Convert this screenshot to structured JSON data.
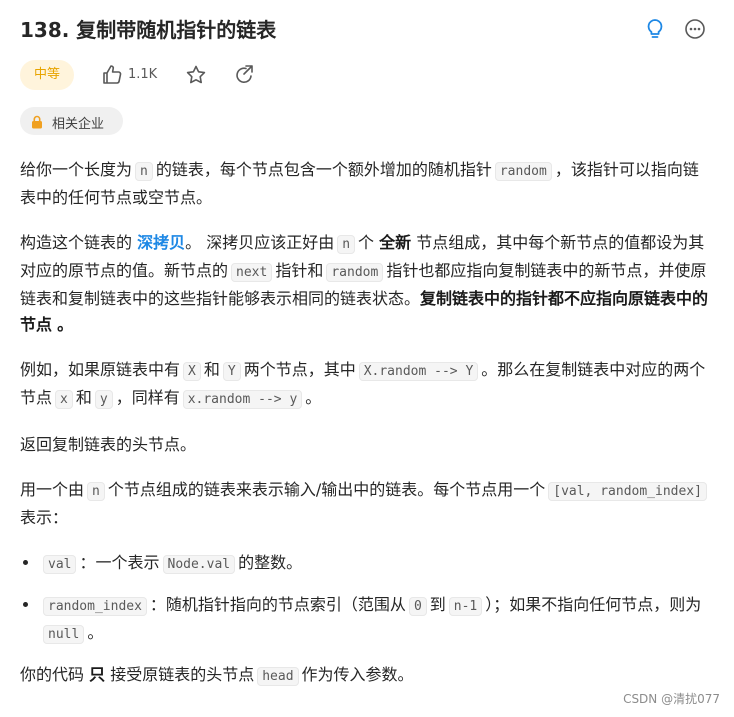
{
  "problem": {
    "title": "138. 复制带随机指针的链表",
    "difficulty": "中等",
    "likes": "1.1K",
    "company_tag": "相关企业"
  },
  "description": {
    "p1": {
      "t1": "给你一个长度为",
      "c1": "n",
      "t2": "的链表，每个节点包含一个额外增加的随机指针",
      "c2": "random",
      "t3": "，该指针可以指向链表中的任何节点或空节点。"
    },
    "p2": {
      "t1": "构造这个链表的",
      "link": "深拷贝",
      "t2": "。 深拷贝应该正好由",
      "c1": "n",
      "t3": "个",
      "b1": "全新",
      "t4": "节点组成，其中每个新节点的值都设为其对应的原节点的值。新节点的",
      "c2": "next",
      "t5": "指针和",
      "c3": "random",
      "t6": "指针也都应指向复制链表中的新节点，并使原链表和复制链表中的这些指针能够表示相同的链表状态。",
      "b2": "复制链表中的指针都不应指向原链表中的节点",
      "t7": "。"
    },
    "p3": {
      "t1": "例如，如果原链表中有",
      "c1": "X",
      "t2": "和",
      "c2": "Y",
      "t3": "两个节点，其中",
      "c3": "X.random --> Y",
      "t4": "。那么在复制链表中对应的两个节点",
      "c4": "x",
      "t5": "和",
      "c5": "y",
      "t6": "，同样有",
      "c6": "x.random --> y",
      "t7": "。"
    },
    "p4": "返回复制链表的头节点。",
    "p5": {
      "t1": "用一个由",
      "c1": "n",
      "t2": "个节点组成的链表来表示输入/输出中的链表。每个节点用一个",
      "c2": "[val, random_index]",
      "t3": "表示："
    },
    "bullets": [
      {
        "c1": "val",
        "t1": "：一个表示",
        "c2": "Node.val",
        "t2": "的整数。"
      },
      {
        "c1": "random_index",
        "t1": "：随机指针指向的节点索引（范围从",
        "c2": "0",
        "t2": "到",
        "c3": "n-1",
        "t3": "）；如果不指向任何节点，则为",
        "c4": "null",
        "t4": "。"
      }
    ],
    "p6": {
      "t1": "你的代码",
      "b1": "只",
      "t2": "接受原链表的头节点",
      "c1": "head",
      "t3": "作为传入参数。"
    }
  },
  "watermark": "CSDN @清扰077",
  "icons": [
    "lightbulb-icon",
    "more-icon",
    "thumbs-up-icon",
    "star-icon",
    "share-icon",
    "lock-icon"
  ],
  "colors": {
    "accent": "#1e88e5",
    "difficulty_text": "#e8a400",
    "difficulty_bg": "#fff4dc"
  }
}
